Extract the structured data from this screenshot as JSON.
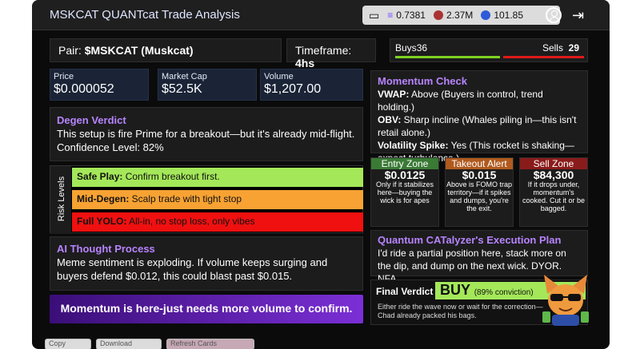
{
  "app": {
    "title": "MSKCAT QUANTcat Trade Analysis"
  },
  "wallet": {
    "sol": "0.7381",
    "token": "2.37M",
    "other": "101.85"
  },
  "pair": {
    "label": "Pair:",
    "value": "$MSKCAT (Muskcat)"
  },
  "timeframe": {
    "label": "Timeframe:",
    "value": "4hs"
  },
  "buysells": {
    "buys_label": "Buys",
    "buys": "36",
    "sells_label": "Sells",
    "sells": "29"
  },
  "stats": [
    {
      "label": "Price",
      "value": "$0.000052"
    },
    {
      "label": "Market Cap",
      "value": "$52.5K"
    },
    {
      "label": "Volume",
      "value": "$1,207.00"
    }
  ],
  "degen": {
    "title": "Degen Verdict",
    "text": "This setup is fire Prime for a breakout—but it's already mid-flight. Confidence Level: 82%"
  },
  "risk": {
    "tag": "Risk Levels",
    "rows": [
      {
        "label": "Safe Play:",
        "text": " Confirm breakout first.",
        "color": "#a4e85a"
      },
      {
        "label": "Mid-Degen:",
        "text": " Scalp trade with tight stop",
        "color": "#f7a233"
      },
      {
        "label": "Full YOLO:",
        "text": " All-in, no stop loss, only vibes",
        "color": "#f01010"
      }
    ]
  },
  "thought": {
    "title": "AI Thought Process",
    "text": "Meme sentiment is exploding. If volume keeps surging and buyers defend $0.012, this could blast past $0.015."
  },
  "banner": "Momentum is here-just needs more volume to confirm.",
  "momentum": {
    "title": "Momentum Check",
    "items": [
      {
        "k": "VWAP:",
        "v": " Above (Buyers in control, trend holding.)"
      },
      {
        "k": "OBV:",
        "v": " Sharp incline (Whales piling in—this isn't retail alone.)"
      },
      {
        "k": "Volatility Spike:",
        "v": " Yes (This rocket is shaking—expect turbulence.)"
      }
    ]
  },
  "zones": [
    {
      "title": "Entry Zone",
      "value": "$0.0125",
      "text": "Only if it stabilizes here—buying the wick is for apes",
      "color": "#3a7a35"
    },
    {
      "title": "Takeout Alert",
      "value": "$0.015",
      "text": "Above is FOMO trap territory—if it spikes and dumps, you're the exit.",
      "color": "#b05a1e"
    },
    {
      "title": "Sell Zone",
      "value": "$84,300",
      "text": "If it drops under, momentum's cooked. Cut it or be bagged.",
      "color": "#8a1b1b"
    }
  ],
  "plan": {
    "title": "Quantum CATalyzer's Execution Plan",
    "text": "I'd ride a partial position here, stack more on the dip, and dump on the next wick. DYOR. NFA."
  },
  "final": {
    "label": "Final Verdict",
    "action": "BUY",
    "conviction": "(89% conviction)",
    "text": "Either ride the wave now or wait for the correction—Chad already packed his bags."
  },
  "ghost": [
    "Copy",
    "Download",
    "Refresh Cards"
  ]
}
